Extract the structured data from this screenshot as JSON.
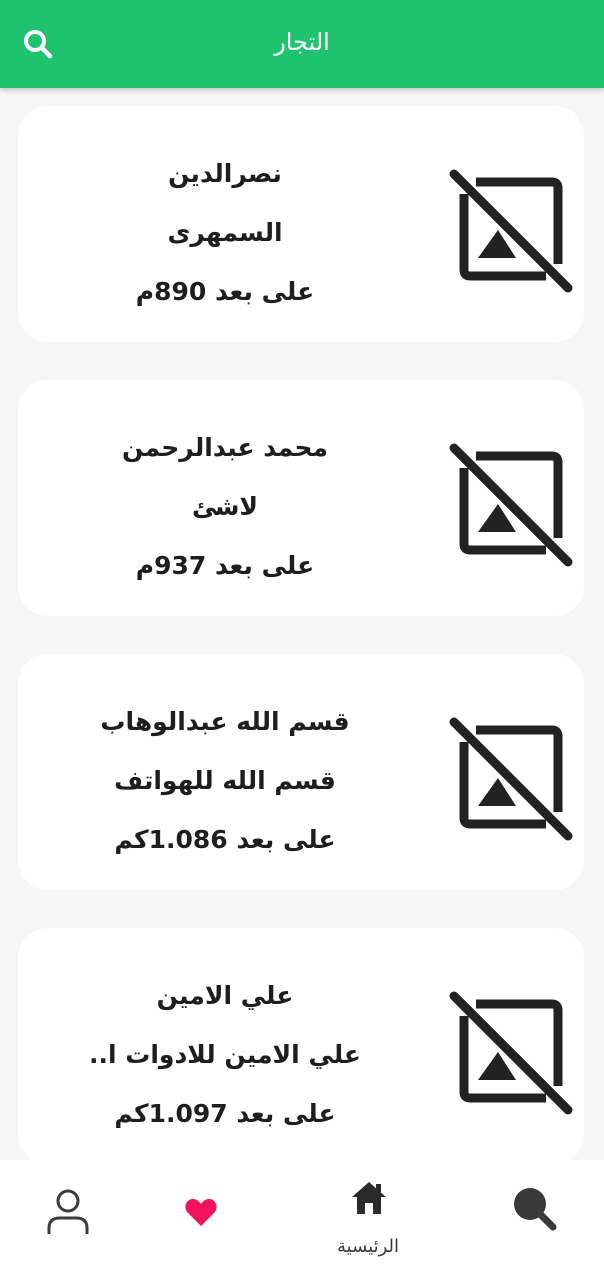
{
  "header": {
    "title": "التجار",
    "search_icon": "search-icon"
  },
  "merchants": [
    {
      "name": "نصرالدين",
      "shop": "السمهرى",
      "distance": "على بعد 890م",
      "image_icon": "image-not-supported-icon"
    },
    {
      "name": "محمد عبدالرحمن",
      "shop": "لاشئ",
      "distance": "على بعد 937م",
      "image_icon": "image-not-supported-icon"
    },
    {
      "name": "قسم الله عبدالوهاب",
      "shop": "قسم الله للهواتف",
      "distance": "على بعد 1.086كم",
      "image_icon": "image-not-supported-icon"
    },
    {
      "name": "علي الامين",
      "shop": "علي الامين للادوات ا..",
      "distance": "على بعد 1.097كم",
      "image_icon": "image-not-supported-icon"
    }
  ],
  "bottom_nav": {
    "items": [
      {
        "icon": "person-icon",
        "label": ""
      },
      {
        "icon": "heart-icon",
        "label": ""
      },
      {
        "icon": "home-icon",
        "label": "الرئيسية"
      },
      {
        "icon": "search-icon",
        "label": ""
      }
    ]
  },
  "colors": {
    "primary": "#1fc26e",
    "favorite": "#f0135a",
    "text": "#1e1e1e",
    "background": "#f6f6f6"
  }
}
